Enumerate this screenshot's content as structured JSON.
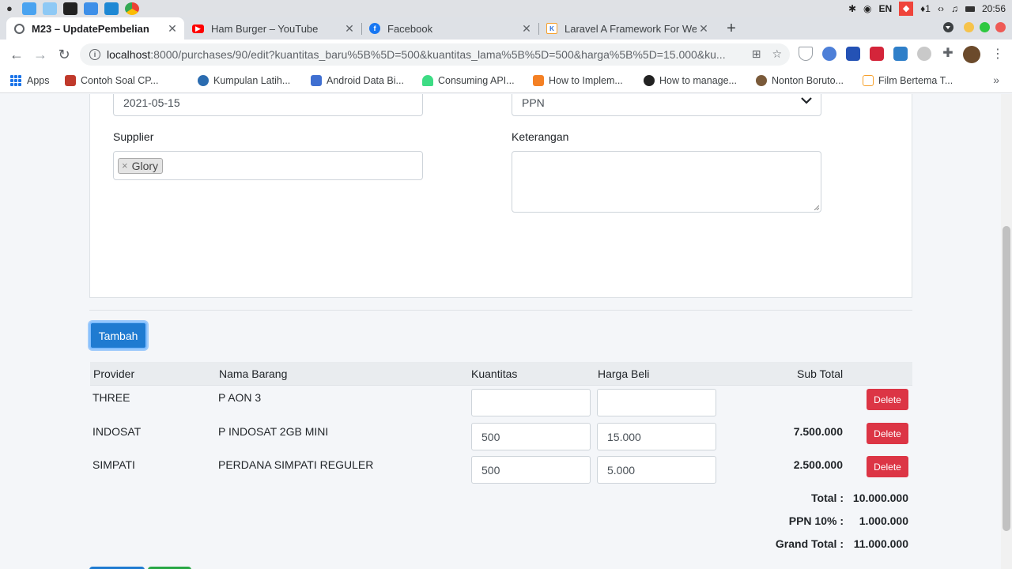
{
  "os": {
    "lang": "EN",
    "badge": "1",
    "clock": "20:56"
  },
  "tabs": [
    {
      "title": "M23 – UpdatePembelian",
      "favicon": "chrome-globe-icon",
      "active": true
    },
    {
      "title": "Ham Burger – YouTube",
      "favicon": "youtube-icon",
      "active": false
    },
    {
      "title": "Facebook",
      "favicon": "facebook-icon",
      "active": false
    },
    {
      "title": "Laravel A Framework For We",
      "favicon": "laravel-icon",
      "active": false
    }
  ],
  "omnibox": {
    "host": "localhost",
    "rest": ":8000/purchases/90/edit?kuantitas_baru%5B%5D=500&kuantitas_lama%5B%5D=500&harga%5B%5D=15.000&ku..."
  },
  "bookmarks": [
    {
      "label": "Apps",
      "icon": "apps-grid-icon"
    },
    {
      "label": "Contoh Soal CP...",
      "icon": "crown-icon"
    },
    {
      "label": "Kumpulan Latih...",
      "icon": "site-icon"
    },
    {
      "label": "Android Data Bi...",
      "icon": "shield-icon"
    },
    {
      "label": "Consuming API...",
      "icon": "android-icon"
    },
    {
      "label": "How to Implem...",
      "icon": "stackoverflow-icon"
    },
    {
      "label": "How to manage...",
      "icon": "wordpress-icon"
    },
    {
      "label": "Nonton Boruto...",
      "icon": "anime-icon"
    },
    {
      "label": "Film Bertema T...",
      "icon": "laravel-icon"
    }
  ],
  "form": {
    "date_value": "2021-05-15",
    "pajak_value": "PPN",
    "supplier_label": "Supplier",
    "supplier_tag": "Glory",
    "supplier_tag_remove": "×",
    "keterangan_label": "Keterangan"
  },
  "buttons": {
    "tambah": "Tambah",
    "delete": "Delete"
  },
  "table": {
    "headers": [
      "Provider",
      "Nama Barang",
      "Kuantitas",
      "Harga Beli",
      "Sub Total"
    ],
    "rows": [
      {
        "provider": "THREE",
        "nama": "P AON 3",
        "kuantitas": "",
        "harga": "",
        "subtotal": ""
      },
      {
        "provider": "INDOSAT",
        "nama": "P INDOSAT 2GB MINI",
        "kuantitas": "500",
        "harga": "15.000",
        "subtotal": "7.500.000"
      },
      {
        "provider": "SIMPATI",
        "nama": "PERDANA SIMPATI REGULER",
        "kuantitas": "500",
        "harga": "5.000",
        "subtotal": "2.500.000"
      }
    ]
  },
  "summary": {
    "total_label": "Total :",
    "total_value": "10.000.000",
    "ppn_label": "PPN 10% :",
    "ppn_value": "1.000.000",
    "grand_label": "Grand Total :",
    "grand_value": "11.000.000"
  },
  "colors": {
    "primary": "#1f7bd1",
    "danger": "#dc3545",
    "success": "#28a745"
  }
}
